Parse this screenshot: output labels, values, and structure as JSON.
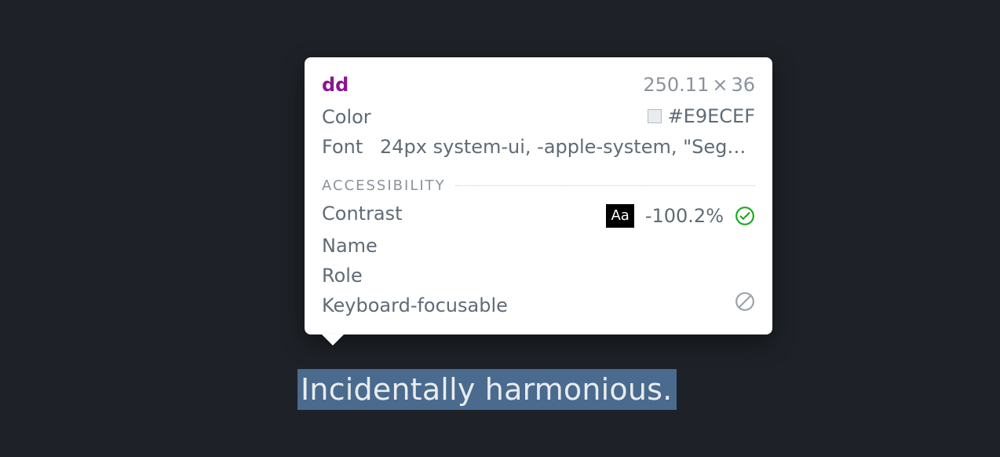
{
  "highlight": {
    "text": "Incidentally harmonious."
  },
  "tooltip": {
    "tag": "dd",
    "dimensions": {
      "w": "250.11",
      "h": "36"
    },
    "style": {
      "color_label": "Color",
      "color_value": "#E9ECEF",
      "font_label": "Font",
      "font_value": "24px system-ui, -apple-system, \"Segoe…"
    },
    "a11y": {
      "heading": "ACCESSIBILITY",
      "contrast_label": "Contrast",
      "contrast_sample": "Aa",
      "contrast_value": "-100.2%",
      "name_label": "Name",
      "role_label": "Role",
      "focusable_label": "Keyboard-focusable"
    }
  }
}
